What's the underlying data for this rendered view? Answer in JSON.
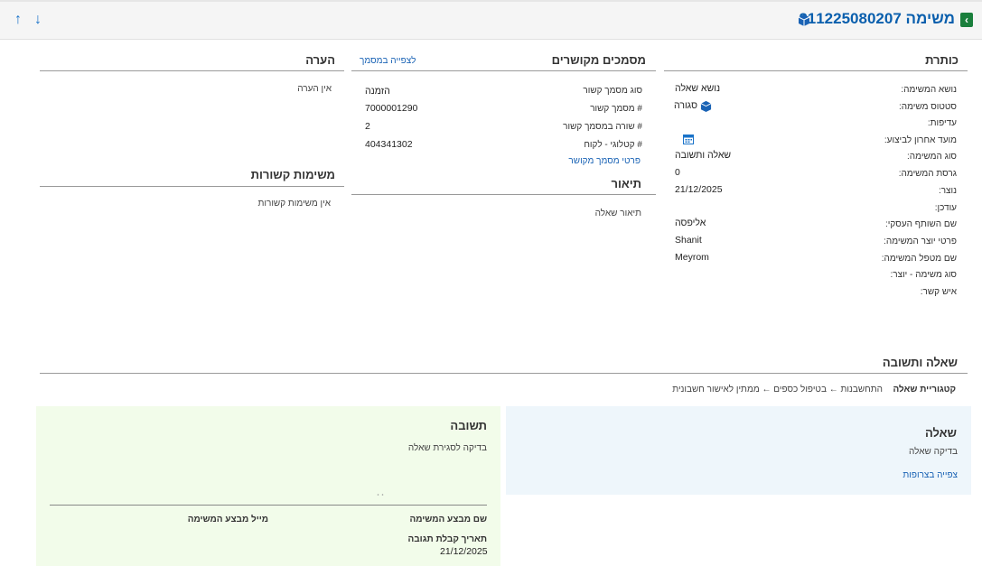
{
  "header": {
    "title": "משימה 211225080207",
    "back_icon": "chevron-left-icon",
    "up_icon": "arrow-up-icon",
    "down_icon": "arrow-down-icon",
    "up_glyph": "↑",
    "down_glyph": "↓",
    "back_glyph": "‹"
  },
  "details": {
    "title": "כותרת",
    "rows": [
      {
        "label": "נושא המשימה:",
        "value": "נושא שאלה"
      },
      {
        "label": "סטטוס משימה:",
        "value": "סגורה"
      },
      {
        "label": "עדיפות:",
        "value": ""
      },
      {
        "label": "מועד אחרון לביצוע:",
        "value": ""
      },
      {
        "label": "סוג המשימה:",
        "value": "שאלה ותשובה"
      },
      {
        "label": "גרסת המשימה:",
        "value": "0"
      },
      {
        "label": "נוצר:",
        "value": "21/12/2025"
      },
      {
        "label": "עודכן:",
        "value": ""
      },
      {
        "label": "שם השותף העסקי:",
        "value": "אליפסה"
      },
      {
        "label": "פרטי יוצר המשימה:",
        "value": "Shanit"
      },
      {
        "label": "שם מטפל המשימה:",
        "value": "Meyrom"
      },
      {
        "label": "סוג משימה - יוצר:",
        "value": ""
      },
      {
        "label": "איש קשר:",
        "value": ""
      }
    ]
  },
  "related_docs": {
    "title": "מסמכים מקושרים",
    "view_link": "לצפייה במסמך",
    "rows": [
      {
        "label": "סוג מסמך קשור",
        "value": "הזמנה"
      },
      {
        "label": "# מסמך קשור",
        "value": "7000001290"
      },
      {
        "label": "# שורה במסמך קשור",
        "value": "2"
      },
      {
        "label": "# קטלוגי - לקוח",
        "value": "404341302"
      }
    ],
    "details_link": "פרטי מסמך מקושר"
  },
  "description": {
    "title": "תיאור",
    "text": "תיאור שאלה"
  },
  "note": {
    "title": "הערה",
    "text": "אין הערה"
  },
  "related_tasks": {
    "title": "משימות קשורות",
    "text": "אין משימות קשורות"
  },
  "qa": {
    "title": "שאלה ותשובה",
    "category_label": "קטגוריית שאלה",
    "category_path": "התחשבנות ← בטיפול כספים ← ממתין לאישור חשבונית",
    "question": {
      "title": "שאלה",
      "text": "בדיקה שאלה",
      "attachments_link": "צפייה בצרופות"
    },
    "answer": {
      "title": "תשובה",
      "text": "בדיקה לסגירת שאלה",
      "performer_name_label": "שם מבצע המשימה",
      "performer_email_label": "מייל מבצע המשימה",
      "response_date_label": "תאריך קבלת תגובה",
      "response_date": "21/12/2025"
    }
  },
  "colors": {
    "accent": "#0a5fad",
    "back_button": "#1a7f3c",
    "question_bg": "#eef6fb",
    "answer_bg": "#f2fcea"
  }
}
